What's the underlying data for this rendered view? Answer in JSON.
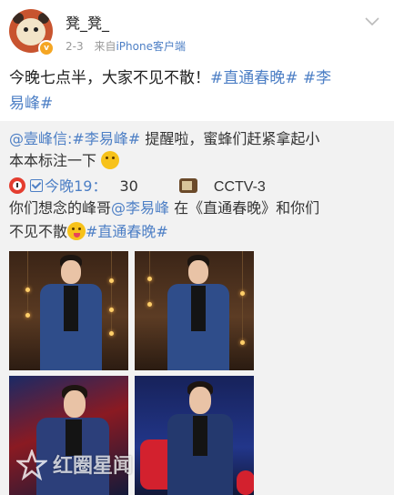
{
  "header": {
    "username": "凳_凳_",
    "date": "2-3",
    "client_prefix": "来自",
    "client_name": "iPhone",
    "client_suffix": "客户端",
    "badge": "v"
  },
  "post": {
    "text": "今晚七点半，大家不见不散！",
    "topic1": "#直通春晚#",
    "topic2_part1": "#李",
    "topic2_part2": "易峰#"
  },
  "repost": {
    "mention": "@壹峰信",
    "colon": ":",
    "topic": "#李易峰#",
    "text1": " 提醒啦，蜜蜂们赶紧拿起小",
    "text2": "本本标注一下",
    "time_label": "今晚19：",
    "time_minutes": "30",
    "channel": "CCTV-3",
    "text3": "你们想念的峰哥",
    "mention2": "@李易峰",
    "text4": " 在《直通春晚》和你们",
    "text5": "不见不散",
    "topic2": "#直通春晚#"
  },
  "watermark": {
    "text": "红圈星闻"
  },
  "colors": {
    "link": "#4d7fc5",
    "repost_bg": "#f2f2f2",
    "muted": "#999999"
  },
  "icons": [
    "chevron-down-icon",
    "verified-badge-icon",
    "alarm-clock-icon",
    "checkbox-icon",
    "tv-icon",
    "grinning-tongue-emoji",
    "smiling-emoji"
  ]
}
